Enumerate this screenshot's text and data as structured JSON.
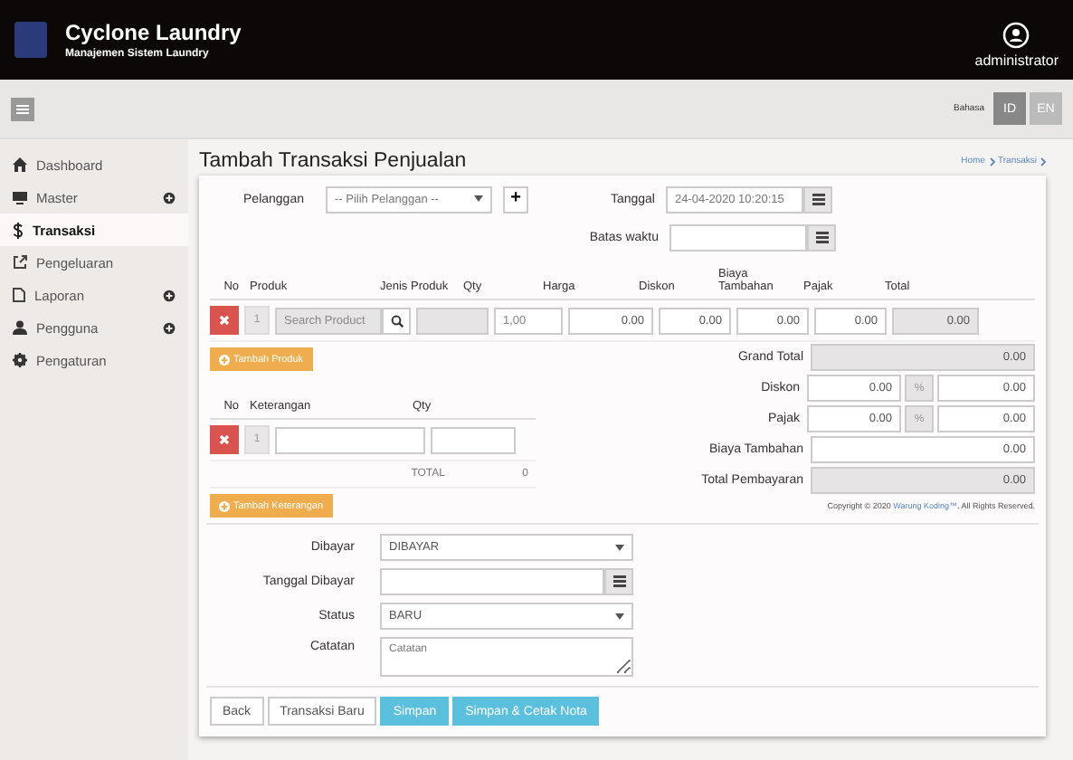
{
  "header": {
    "title": "Cyclone Laundry",
    "subtitle": "Manajemen Sistem Laundry",
    "user": "administrator"
  },
  "toolbar": {
    "language_label": "Bahasa",
    "languages": [
      {
        "label": "ID",
        "selected": true
      },
      {
        "label": "EN",
        "selected": false
      }
    ]
  },
  "sidebar": {
    "items": [
      {
        "label": "Dashboard",
        "expandable": false,
        "selected": false
      },
      {
        "label": "Master",
        "expandable": true,
        "selected": false
      },
      {
        "label": "Transaksi",
        "expandable": false,
        "selected": true
      },
      {
        "label": "Pengeluaran",
        "expandable": false,
        "selected": false
      },
      {
        "label": "Laporan",
        "expandable": true,
        "selected": false
      },
      {
        "label": "Pengguna",
        "expandable": true,
        "selected": false
      },
      {
        "label": "Pengaturan",
        "expandable": false,
        "selected": false
      }
    ]
  },
  "page": {
    "title": "Tambah Transaksi Penjualan",
    "breadcrumb": [
      "Home",
      "Transaksi"
    ]
  },
  "form": {
    "customer": {
      "label": "Pelanggan",
      "placeholder": "-- Pilih Pelanggan --",
      "add": "+"
    },
    "date": {
      "label": "Tanggal",
      "value": "24-04-2020 10:20:15"
    },
    "due": {
      "label": "Batas waktu"
    }
  },
  "products": {
    "columns": [
      "No",
      "Produk",
      "Jenis Produk",
      "Qty",
      "Harga",
      "Diskon",
      "Biaya Tambahan",
      "Pajak",
      "Total"
    ],
    "rows": [
      {
        "no": "1",
        "product_placeholder": "Search Product",
        "qty": "1,00",
        "harga": "0.00",
        "diskon": "0.00",
        "biaya": "0.00",
        "pajak": "0.00",
        "total": "0.00"
      }
    ],
    "add_button": "Tambah Produk"
  },
  "summary": {
    "grand_total": {
      "label": "Grand Total",
      "value": "0.00"
    },
    "diskon": {
      "label": "Diskon",
      "percent": "0.00",
      "unit": "%",
      "value": "0.00"
    },
    "pajak": {
      "label": "Pajak",
      "percent": "0.00",
      "unit": "%",
      "value": "0.00"
    },
    "biaya_tambahan": {
      "label": "Biaya Tambahan",
      "value": "0.00"
    },
    "total_pembayaran": {
      "label": "Total Pembayaran",
      "value": "0.00"
    }
  },
  "notes": {
    "columns": [
      "No",
      "Keterangan",
      "Qty"
    ],
    "rows": [
      {
        "no": "1"
      }
    ],
    "total_label": "TOTAL",
    "total_value": "0",
    "add_button": "Tambah Keterangan"
  },
  "payment": {
    "dibayar": {
      "label": "Dibayar",
      "value": "DIBAYAR"
    },
    "tanggal_dibayar": {
      "label": "Tanggal Dibayar"
    },
    "status": {
      "label": "Status",
      "value": "BARU"
    },
    "catatan": {
      "label": "Catatan",
      "placeholder": "Catatan"
    }
  },
  "buttons": [
    {
      "label": "Back",
      "kind": "default"
    },
    {
      "label": "Transaksi Baru",
      "kind": "default"
    },
    {
      "label": "Simpan",
      "kind": "primary"
    },
    {
      "label": "Simpan & Cetak Nota",
      "kind": "primary"
    }
  ],
  "copyright": {
    "text": "Copyright © 2020",
    "link": "Warung Koding™",
    "rest": ". All Rights Reserved."
  }
}
